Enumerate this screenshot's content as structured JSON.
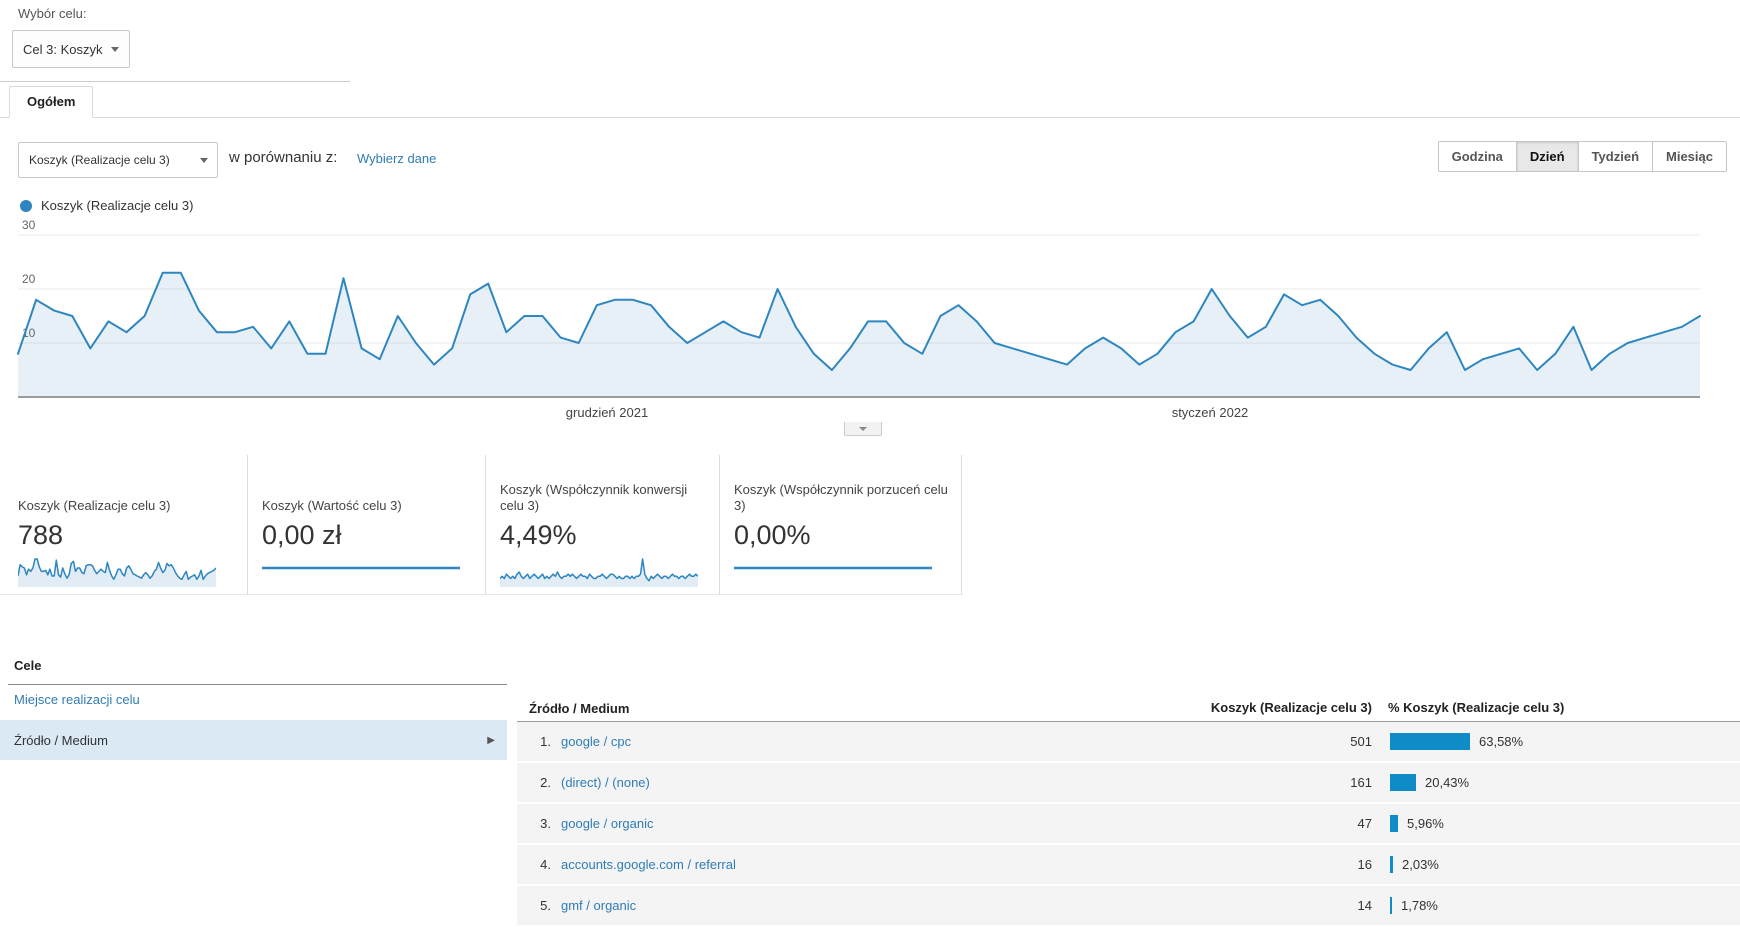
{
  "goal_selector": {
    "label": "Wybór celu:",
    "value": "Cel 3: Koszyk"
  },
  "tabs": [
    {
      "label": "Ogółem",
      "active": true
    }
  ],
  "toolbar": {
    "metric_dropdown_value": "Koszyk (Realizacje celu 3)",
    "compare_label": "w porównaniu z:",
    "compare_link": "Wybierz dane",
    "intervals": [
      {
        "label": "Godzina",
        "active": false
      },
      {
        "label": "Dzień",
        "active": true
      },
      {
        "label": "Tydzień",
        "active": false
      },
      {
        "label": "Miesiąc",
        "active": false
      }
    ]
  },
  "chart_data": {
    "type": "area",
    "legend": "Koszyk (Realizacje celu 3)",
    "series": [
      {
        "name": "Koszyk (Realizacje celu 3)",
        "values": [
          8,
          18,
          16,
          15,
          9,
          14,
          12,
          15,
          23,
          23,
          16,
          12,
          12,
          13,
          9,
          14,
          8,
          8,
          22,
          9,
          7,
          15,
          10,
          6,
          9,
          19,
          21,
          12,
          15,
          15,
          11,
          10,
          17,
          18,
          18,
          17,
          13,
          10,
          12,
          14,
          12,
          11,
          20,
          13,
          8,
          5,
          9,
          14,
          14,
          10,
          8,
          15,
          17,
          14,
          10,
          9,
          8,
          7,
          6,
          9,
          11,
          9,
          6,
          8,
          12,
          14,
          20,
          15,
          11,
          13,
          19,
          17,
          18,
          15,
          11,
          8,
          6,
          5,
          9,
          12,
          5,
          7,
          8,
          9,
          5,
          8,
          13,
          5,
          8,
          10,
          11,
          12,
          13,
          15
        ]
      }
    ],
    "ylim": [
      0,
      30
    ],
    "yticks": [
      10,
      20,
      30
    ],
    "x_axis_labels": [
      "grudzień 2021",
      "styczeń 2022"
    ],
    "grid": true,
    "line_color": "#2e86c0",
    "fill_color": "rgba(60,130,190,0.12)"
  },
  "scorecards": [
    {
      "title": "Koszyk (Realizacje celu 3)",
      "value": "788",
      "spark": "main"
    },
    {
      "title": "Koszyk (Wartość celu 3)",
      "value": "0,00 zł",
      "spark": "flat"
    },
    {
      "title": "Koszyk (Współczynnik konwersji celu 3)",
      "value": "4,49%",
      "spark": "conv"
    },
    {
      "title": "Koszyk (Współczynnik porzuceń celu 3)",
      "value": "0,00%",
      "spark": "flat"
    }
  ],
  "spark_conv_values": [
    3,
    4,
    3,
    5,
    4,
    3,
    4,
    3,
    5,
    6,
    4,
    3,
    4,
    5,
    3,
    4,
    5,
    4,
    3,
    4,
    5,
    3,
    4,
    3,
    4,
    5,
    4,
    6,
    4,
    3,
    4,
    4,
    5,
    4,
    5,
    4,
    3,
    4,
    5,
    4,
    4,
    3,
    5,
    4,
    3,
    3,
    4,
    4,
    5,
    4,
    3,
    4,
    5,
    5,
    4,
    3,
    4,
    3,
    3,
    4,
    4,
    3,
    4,
    3,
    4,
    4,
    5,
    12,
    5,
    3,
    2,
    4,
    3,
    4,
    5,
    4,
    3,
    4,
    4,
    3,
    4,
    5,
    4,
    4,
    3,
    4,
    4,
    3,
    4,
    5,
    4,
    4,
    5,
    4
  ],
  "nav": {
    "header": "Cele",
    "items": [
      {
        "label": "Miejsce realizacji celu",
        "active": false
      },
      {
        "label": "Źródło / Medium",
        "active": true
      }
    ]
  },
  "table": {
    "columns": [
      "Źródło / Medium",
      "Koszyk (Realizacje celu 3)",
      "% Koszyk (Realizacje celu 3)"
    ],
    "rows": [
      {
        "rank": "1.",
        "source": "google / cpc",
        "value": "501",
        "pct": "63,58%",
        "pct_num": 63.58
      },
      {
        "rank": "2.",
        "source": "(direct) / (none)",
        "value": "161",
        "pct": "20,43%",
        "pct_num": 20.43
      },
      {
        "rank": "3.",
        "source": "google / organic",
        "value": "47",
        "pct": "5,96%",
        "pct_num": 5.96
      },
      {
        "rank": "4.",
        "source": "accounts.google.com / referral",
        "value": "16",
        "pct": "2,03%",
        "pct_num": 2.03
      },
      {
        "rank": "5.",
        "source": "gmf / organic",
        "value": "14",
        "pct": "1,78%",
        "pct_num": 1.78
      }
    ]
  },
  "colors": {
    "line": "#2e86c0",
    "bar": "#0f8bc7",
    "link": "#2f7cb5",
    "selected_row_bg": "#dbe9f4",
    "table_row_bg": "#f4f4f4"
  },
  "icons": {
    "dropdown_arrow": "▼",
    "collapse_arrow": "▼",
    "nav_arrow": "▶"
  }
}
